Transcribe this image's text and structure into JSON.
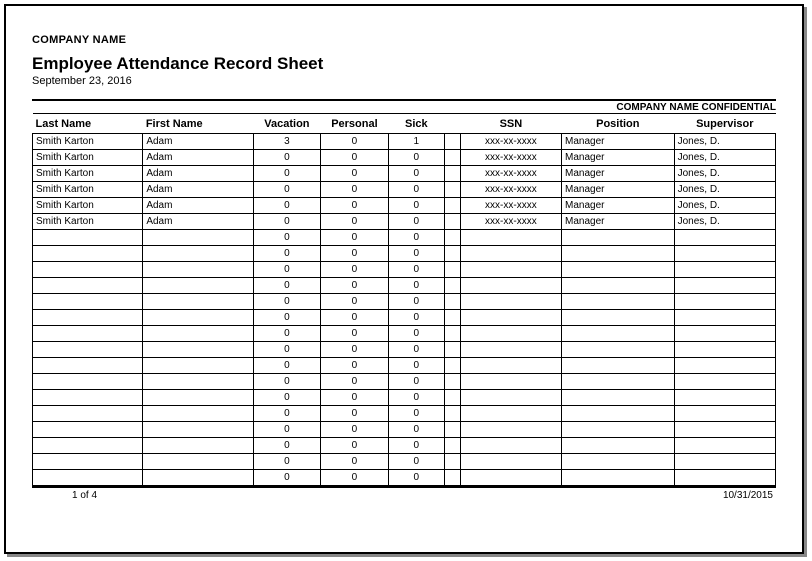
{
  "header": {
    "company": "COMPANY NAME",
    "title": "Employee Attendance Record Sheet",
    "date": "September 23, 2016",
    "confidential": "COMPANY NAME CONFIDENTIAL"
  },
  "columns": {
    "last_name": "Last Name",
    "first_name": "First Name",
    "vacation": "Vacation",
    "personal": "Personal",
    "sick": "Sick",
    "ssn": "SSN",
    "position": "Position",
    "supervisor": "Supervisor"
  },
  "rows": [
    {
      "last": "Smith Karton",
      "first": "Adam",
      "vac": "3",
      "per": "0",
      "sick": "1",
      "ssn": "xxx-xx-xxxx",
      "pos": "Manager",
      "sup": "Jones, D."
    },
    {
      "last": "Smith Karton",
      "first": "Adam",
      "vac": "0",
      "per": "0",
      "sick": "0",
      "ssn": "xxx-xx-xxxx",
      "pos": "Manager",
      "sup": "Jones, D."
    },
    {
      "last": "Smith Karton",
      "first": "Adam",
      "vac": "0",
      "per": "0",
      "sick": "0",
      "ssn": "xxx-xx-xxxx",
      "pos": "Manager",
      "sup": "Jones, D."
    },
    {
      "last": "Smith Karton",
      "first": "Adam",
      "vac": "0",
      "per": "0",
      "sick": "0",
      "ssn": "xxx-xx-xxxx",
      "pos": "Manager",
      "sup": "Jones, D."
    },
    {
      "last": "Smith Karton",
      "first": "Adam",
      "vac": "0",
      "per": "0",
      "sick": "0",
      "ssn": "xxx-xx-xxxx",
      "pos": "Manager",
      "sup": "Jones, D."
    },
    {
      "last": "Smith Karton",
      "first": "Adam",
      "vac": "0",
      "per": "0",
      "sick": "0",
      "ssn": "xxx-xx-xxxx",
      "pos": "Manager",
      "sup": "Jones, D."
    },
    {
      "last": "",
      "first": "",
      "vac": "0",
      "per": "0",
      "sick": "0",
      "ssn": "",
      "pos": "",
      "sup": ""
    },
    {
      "last": "",
      "first": "",
      "vac": "0",
      "per": "0",
      "sick": "0",
      "ssn": "",
      "pos": "",
      "sup": ""
    },
    {
      "last": "",
      "first": "",
      "vac": "0",
      "per": "0",
      "sick": "0",
      "ssn": "",
      "pos": "",
      "sup": ""
    },
    {
      "last": "",
      "first": "",
      "vac": "0",
      "per": "0",
      "sick": "0",
      "ssn": "",
      "pos": "",
      "sup": ""
    },
    {
      "last": "",
      "first": "",
      "vac": "0",
      "per": "0",
      "sick": "0",
      "ssn": "",
      "pos": "",
      "sup": ""
    },
    {
      "last": "",
      "first": "",
      "vac": "0",
      "per": "0",
      "sick": "0",
      "ssn": "",
      "pos": "",
      "sup": ""
    },
    {
      "last": "",
      "first": "",
      "vac": "0",
      "per": "0",
      "sick": "0",
      "ssn": "",
      "pos": "",
      "sup": ""
    },
    {
      "last": "",
      "first": "",
      "vac": "0",
      "per": "0",
      "sick": "0",
      "ssn": "",
      "pos": "",
      "sup": ""
    },
    {
      "last": "",
      "first": "",
      "vac": "0",
      "per": "0",
      "sick": "0",
      "ssn": "",
      "pos": "",
      "sup": ""
    },
    {
      "last": "",
      "first": "",
      "vac": "0",
      "per": "0",
      "sick": "0",
      "ssn": "",
      "pos": "",
      "sup": ""
    },
    {
      "last": "",
      "first": "",
      "vac": "0",
      "per": "0",
      "sick": "0",
      "ssn": "",
      "pos": "",
      "sup": ""
    },
    {
      "last": "",
      "first": "",
      "vac": "0",
      "per": "0",
      "sick": "0",
      "ssn": "",
      "pos": "",
      "sup": ""
    },
    {
      "last": "",
      "first": "",
      "vac": "0",
      "per": "0",
      "sick": "0",
      "ssn": "",
      "pos": "",
      "sup": ""
    },
    {
      "last": "",
      "first": "",
      "vac": "0",
      "per": "0",
      "sick": "0",
      "ssn": "",
      "pos": "",
      "sup": ""
    },
    {
      "last": "",
      "first": "",
      "vac": "0",
      "per": "0",
      "sick": "0",
      "ssn": "",
      "pos": "",
      "sup": ""
    },
    {
      "last": "",
      "first": "",
      "vac": "0",
      "per": "0",
      "sick": "0",
      "ssn": "",
      "pos": "",
      "sup": ""
    }
  ],
  "footer": {
    "page": "1 of 4",
    "date": "10/31/2015"
  }
}
